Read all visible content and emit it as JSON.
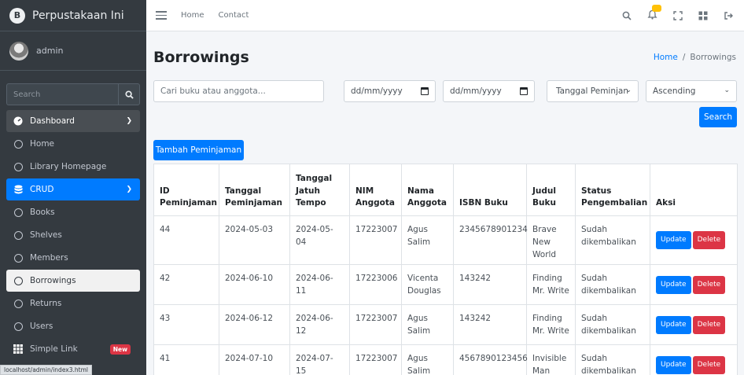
{
  "brand": {
    "name": "Perpustakaan Ini",
    "logo_letter": "B"
  },
  "user": {
    "name": "admin"
  },
  "sidebar": {
    "search_placeholder": "Search",
    "items": [
      {
        "label": "Dashboard",
        "icon": "dashboard-icon"
      },
      {
        "label": "Home",
        "icon": "circle-icon"
      },
      {
        "label": "Library Homepage",
        "icon": "circle-icon"
      },
      {
        "label": "CRUD",
        "icon": "database-icon"
      },
      {
        "label": "Books",
        "icon": "circle-icon"
      },
      {
        "label": "Shelves",
        "icon": "circle-icon"
      },
      {
        "label": "Members",
        "icon": "circle-icon"
      },
      {
        "label": "Borrowings",
        "icon": "circle-icon"
      },
      {
        "label": "Returns",
        "icon": "circle-icon"
      },
      {
        "label": "Users",
        "icon": "circle-icon"
      },
      {
        "label": "Simple Link",
        "icon": "grid-icon",
        "badge": "New"
      }
    ],
    "status_url": "localhost/admin/index3.html"
  },
  "topbar": {
    "home": "Home",
    "contact": "Contact"
  },
  "page": {
    "title": "Borrowings",
    "breadcrumb_home": "Home",
    "breadcrumb_sep": "/",
    "breadcrumb_current": "Borrowings"
  },
  "filters": {
    "search_placeholder": "Cari buku atau anggota...",
    "date_from": "dd/mm/yyyy",
    "date_to": "dd/mm/yyyy",
    "sort_by": "Tanggal Peminjan",
    "order": "Ascending",
    "search_button": "Search"
  },
  "add_button": "Tambah Peminjaman",
  "table": {
    "headers": [
      "ID Peminjaman",
      "Tanggal Peminjaman",
      "Tanggal Jatuh Tempo",
      "NIM Anggota",
      "Nama Anggota",
      "ISBN Buku",
      "Judul Buku",
      "Status Pengembalian",
      "Aksi"
    ],
    "rows": [
      [
        "44",
        "2024-05-03",
        "2024-05-04",
        "17223007",
        "Agus Salim",
        "2345678901234",
        "Brave New World",
        "Sudah dikembalikan"
      ],
      [
        "42",
        "2024-06-10",
        "2024-06-11",
        "17223006",
        "Vicenta Douglas",
        "143242",
        "Finding Mr. Write",
        "Sudah dikembalikan"
      ],
      [
        "43",
        "2024-06-12",
        "2024-06-12",
        "17223007",
        "Agus Salim",
        "143242",
        "Finding Mr. Write",
        "Sudah dikembalikan"
      ],
      [
        "41",
        "2024-07-10",
        "2024-07-15",
        "17223007",
        "Agus Salim",
        "4567890123456",
        "Invisible Man",
        "Sudah dikembalikan"
      ]
    ],
    "update_label": "Update",
    "delete_label": "Delete"
  },
  "colors": {
    "primary": "#007bff",
    "danger": "#dc3545",
    "sidebar": "#343a40",
    "warning": "#ffc107"
  }
}
